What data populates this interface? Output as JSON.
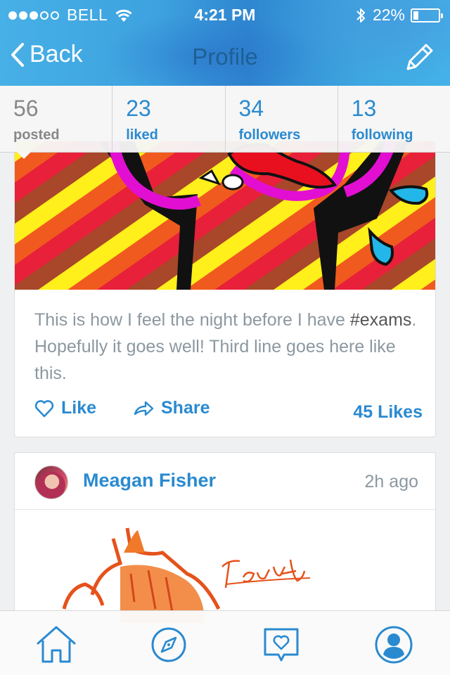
{
  "status_bar": {
    "carrier": "BELL",
    "signal_bars": 3,
    "time": "4:21 PM",
    "battery": "22%",
    "battery_level": 0.22
  },
  "nav": {
    "back_label": "Back",
    "title": "Profile",
    "edit_icon": "pencil-icon"
  },
  "stats": [
    {
      "count": "56",
      "label": "posted"
    },
    {
      "count": "23",
      "label": "liked"
    },
    {
      "count": "34",
      "label": "followers"
    },
    {
      "count": "13",
      "label": "following"
    }
  ],
  "post1": {
    "caption_before": "This is how I feel the night before I have ",
    "hashtag": "#exams",
    "caption_after": ". Hopefully it goes well! Third line goes here like this.",
    "like_label": "Like",
    "share_label": "Share",
    "likes_count": "45 Likes"
  },
  "post2": {
    "author": "Meagan Fisher",
    "timestamp": "2h ago"
  },
  "tabbar": [
    "home-icon",
    "compass-icon",
    "heart-bubble-icon",
    "person-icon"
  ],
  "colors": {
    "accent": "#2a8ad0",
    "muted_text": "#8c98a0",
    "nav_gradient_start": "#47b0e6",
    "nav_gradient_end": "#2f86d0"
  }
}
